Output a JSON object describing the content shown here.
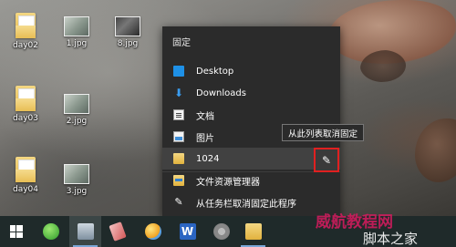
{
  "desktop": {
    "icons": [
      {
        "label": "day02",
        "kind": "folder"
      },
      {
        "label": "1.jpg",
        "kind": "image"
      },
      {
        "label": "8.jpg",
        "kind": "image-dark"
      },
      {
        "label": "day03",
        "kind": "folder"
      },
      {
        "label": "2.jpg",
        "kind": "image"
      },
      {
        "label": "day04",
        "kind": "folder"
      },
      {
        "label": "3.jpg",
        "kind": "image"
      }
    ]
  },
  "jumplist": {
    "header": "固定",
    "items": [
      {
        "label": "Desktop",
        "icon": "desktop-folder-icon"
      },
      {
        "label": "Downloads",
        "icon": "download-arrow-icon"
      },
      {
        "label": "文档",
        "icon": "document-icon"
      },
      {
        "label": "图片",
        "icon": "pictures-icon"
      },
      {
        "label": "1024",
        "icon": "folder-icon"
      },
      {
        "label": "文件资源管理器",
        "icon": "file-explorer-icon"
      },
      {
        "label": "从任务栏取消固定此程序",
        "icon": "unpin-icon"
      }
    ],
    "pin_button_icon": "unpin-icon",
    "tooltip": "从此列表取消固定"
  },
  "taskbar": {
    "buttons": [
      {
        "icon": "windows-start-icon"
      },
      {
        "icon": "green-app-icon"
      },
      {
        "icon": "active-app-icon"
      },
      {
        "icon": "pencil-app-icon"
      },
      {
        "icon": "weather-app-icon"
      },
      {
        "icon": "word-icon"
      },
      {
        "icon": "settings-app-icon"
      },
      {
        "icon": "file-explorer-icon"
      }
    ]
  },
  "watermark": {
    "text": "威航教程网 脚本之家"
  },
  "colors": {
    "jumplist_bg": "#2b2b2b",
    "taskbar_bg": "#1f2a2a",
    "highlight_border": "#e02020"
  }
}
